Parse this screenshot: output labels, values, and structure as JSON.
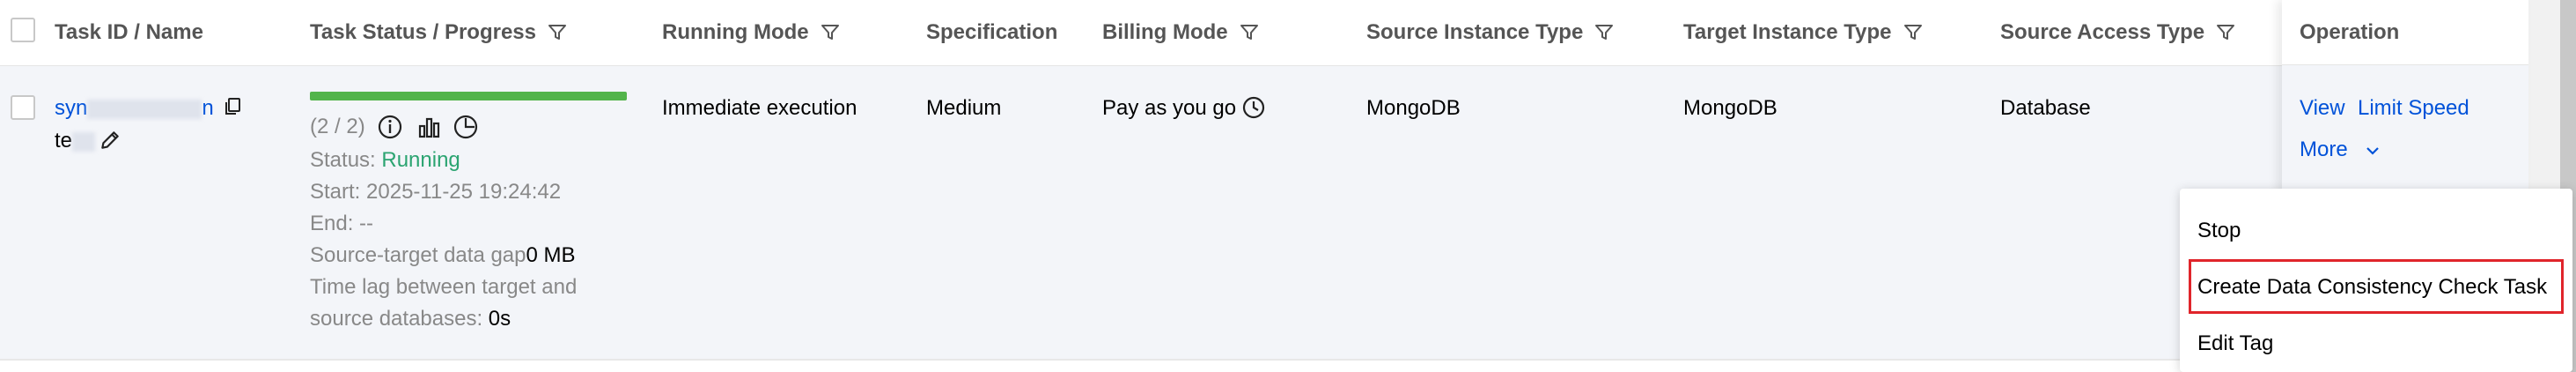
{
  "columns": {
    "task_id": "Task ID / Name",
    "task_status": "Task Status / Progress",
    "running_mode": "Running Mode",
    "specification": "Specification",
    "billing_mode": "Billing Mode",
    "source_instance_type": "Source Instance Type",
    "target_instance_type": "Target Instance Type",
    "source_access_type": "Source Access Type",
    "operation": "Operation"
  },
  "row": {
    "task_id_prefix": "syn",
    "task_id_suffix": "n",
    "task_name_prefix": "te",
    "progress_count": "(2 / 2)",
    "progress_fraction": 1.0,
    "status_label": "Status: ",
    "status_value": "Running",
    "start": "Start: 2025-11-25 19:24:42",
    "end": "End: --",
    "gap_label": "Source-target data gap",
    "gap_value": "0 MB",
    "lag_label_1": "Time lag between target and",
    "lag_label_2": "source databases: ",
    "lag_value": "0s",
    "running_mode": "Immediate execution",
    "specification": "Medium",
    "billing_mode": "Pay as you go",
    "source_instance_type": "MongoDB",
    "target_instance_type": "MongoDB",
    "source_access_type": "Database"
  },
  "operation": {
    "view": "View",
    "limit_speed": "Limit Speed",
    "more": "More"
  },
  "more_menu": {
    "stop": "Stop",
    "create_check": "Create Data Consistency Check Task",
    "edit_tag": "Edit Tag"
  },
  "colors": {
    "link": "#0052d9",
    "running": "#2ba471",
    "progress": "#52b44b",
    "highlight": "#e0252b"
  }
}
